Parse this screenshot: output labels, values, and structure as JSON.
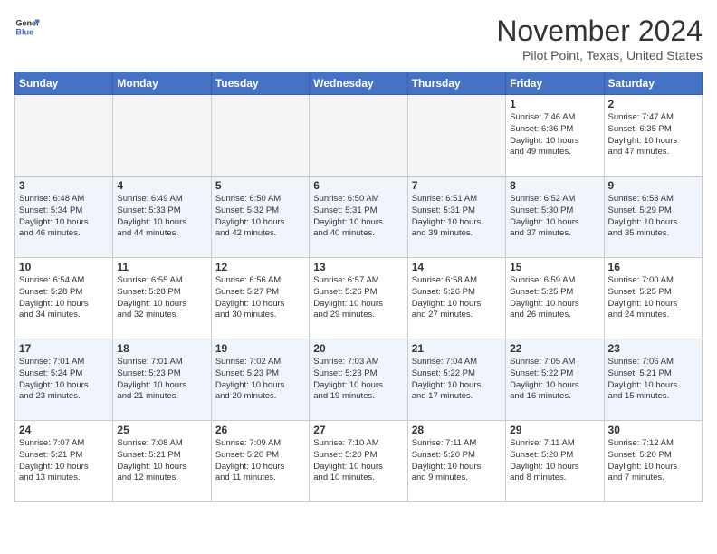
{
  "header": {
    "logo_line1": "General",
    "logo_line2": "Blue",
    "month": "November 2024",
    "location": "Pilot Point, Texas, United States"
  },
  "days_of_week": [
    "Sunday",
    "Monday",
    "Tuesday",
    "Wednesday",
    "Thursday",
    "Friday",
    "Saturday"
  ],
  "weeks": [
    [
      {
        "day": "",
        "empty": true
      },
      {
        "day": "",
        "empty": true
      },
      {
        "day": "",
        "empty": true
      },
      {
        "day": "",
        "empty": true
      },
      {
        "day": "",
        "empty": true
      },
      {
        "day": "1",
        "info": "Sunrise: 7:46 AM\nSunset: 6:36 PM\nDaylight: 10 hours\nand 49 minutes."
      },
      {
        "day": "2",
        "info": "Sunrise: 7:47 AM\nSunset: 6:35 PM\nDaylight: 10 hours\nand 47 minutes."
      }
    ],
    [
      {
        "day": "3",
        "info": "Sunrise: 6:48 AM\nSunset: 5:34 PM\nDaylight: 10 hours\nand 46 minutes."
      },
      {
        "day": "4",
        "info": "Sunrise: 6:49 AM\nSunset: 5:33 PM\nDaylight: 10 hours\nand 44 minutes."
      },
      {
        "day": "5",
        "info": "Sunrise: 6:50 AM\nSunset: 5:32 PM\nDaylight: 10 hours\nand 42 minutes."
      },
      {
        "day": "6",
        "info": "Sunrise: 6:50 AM\nSunset: 5:31 PM\nDaylight: 10 hours\nand 40 minutes."
      },
      {
        "day": "7",
        "info": "Sunrise: 6:51 AM\nSunset: 5:31 PM\nDaylight: 10 hours\nand 39 minutes."
      },
      {
        "day": "8",
        "info": "Sunrise: 6:52 AM\nSunset: 5:30 PM\nDaylight: 10 hours\nand 37 minutes."
      },
      {
        "day": "9",
        "info": "Sunrise: 6:53 AM\nSunset: 5:29 PM\nDaylight: 10 hours\nand 35 minutes."
      }
    ],
    [
      {
        "day": "10",
        "info": "Sunrise: 6:54 AM\nSunset: 5:28 PM\nDaylight: 10 hours\nand 34 minutes."
      },
      {
        "day": "11",
        "info": "Sunrise: 6:55 AM\nSunset: 5:28 PM\nDaylight: 10 hours\nand 32 minutes."
      },
      {
        "day": "12",
        "info": "Sunrise: 6:56 AM\nSunset: 5:27 PM\nDaylight: 10 hours\nand 30 minutes."
      },
      {
        "day": "13",
        "info": "Sunrise: 6:57 AM\nSunset: 5:26 PM\nDaylight: 10 hours\nand 29 minutes."
      },
      {
        "day": "14",
        "info": "Sunrise: 6:58 AM\nSunset: 5:26 PM\nDaylight: 10 hours\nand 27 minutes."
      },
      {
        "day": "15",
        "info": "Sunrise: 6:59 AM\nSunset: 5:25 PM\nDaylight: 10 hours\nand 26 minutes."
      },
      {
        "day": "16",
        "info": "Sunrise: 7:00 AM\nSunset: 5:25 PM\nDaylight: 10 hours\nand 24 minutes."
      }
    ],
    [
      {
        "day": "17",
        "info": "Sunrise: 7:01 AM\nSunset: 5:24 PM\nDaylight: 10 hours\nand 23 minutes."
      },
      {
        "day": "18",
        "info": "Sunrise: 7:01 AM\nSunset: 5:23 PM\nDaylight: 10 hours\nand 21 minutes."
      },
      {
        "day": "19",
        "info": "Sunrise: 7:02 AM\nSunset: 5:23 PM\nDaylight: 10 hours\nand 20 minutes."
      },
      {
        "day": "20",
        "info": "Sunrise: 7:03 AM\nSunset: 5:23 PM\nDaylight: 10 hours\nand 19 minutes."
      },
      {
        "day": "21",
        "info": "Sunrise: 7:04 AM\nSunset: 5:22 PM\nDaylight: 10 hours\nand 17 minutes."
      },
      {
        "day": "22",
        "info": "Sunrise: 7:05 AM\nSunset: 5:22 PM\nDaylight: 10 hours\nand 16 minutes."
      },
      {
        "day": "23",
        "info": "Sunrise: 7:06 AM\nSunset: 5:21 PM\nDaylight: 10 hours\nand 15 minutes."
      }
    ],
    [
      {
        "day": "24",
        "info": "Sunrise: 7:07 AM\nSunset: 5:21 PM\nDaylight: 10 hours\nand 13 minutes."
      },
      {
        "day": "25",
        "info": "Sunrise: 7:08 AM\nSunset: 5:21 PM\nDaylight: 10 hours\nand 12 minutes."
      },
      {
        "day": "26",
        "info": "Sunrise: 7:09 AM\nSunset: 5:20 PM\nDaylight: 10 hours\nand 11 minutes."
      },
      {
        "day": "27",
        "info": "Sunrise: 7:10 AM\nSunset: 5:20 PM\nDaylight: 10 hours\nand 10 minutes."
      },
      {
        "day": "28",
        "info": "Sunrise: 7:11 AM\nSunset: 5:20 PM\nDaylight: 10 hours\nand 9 minutes."
      },
      {
        "day": "29",
        "info": "Sunrise: 7:11 AM\nSunset: 5:20 PM\nDaylight: 10 hours\nand 8 minutes."
      },
      {
        "day": "30",
        "info": "Sunrise: 7:12 AM\nSunset: 5:20 PM\nDaylight: 10 hours\nand 7 minutes."
      }
    ]
  ]
}
